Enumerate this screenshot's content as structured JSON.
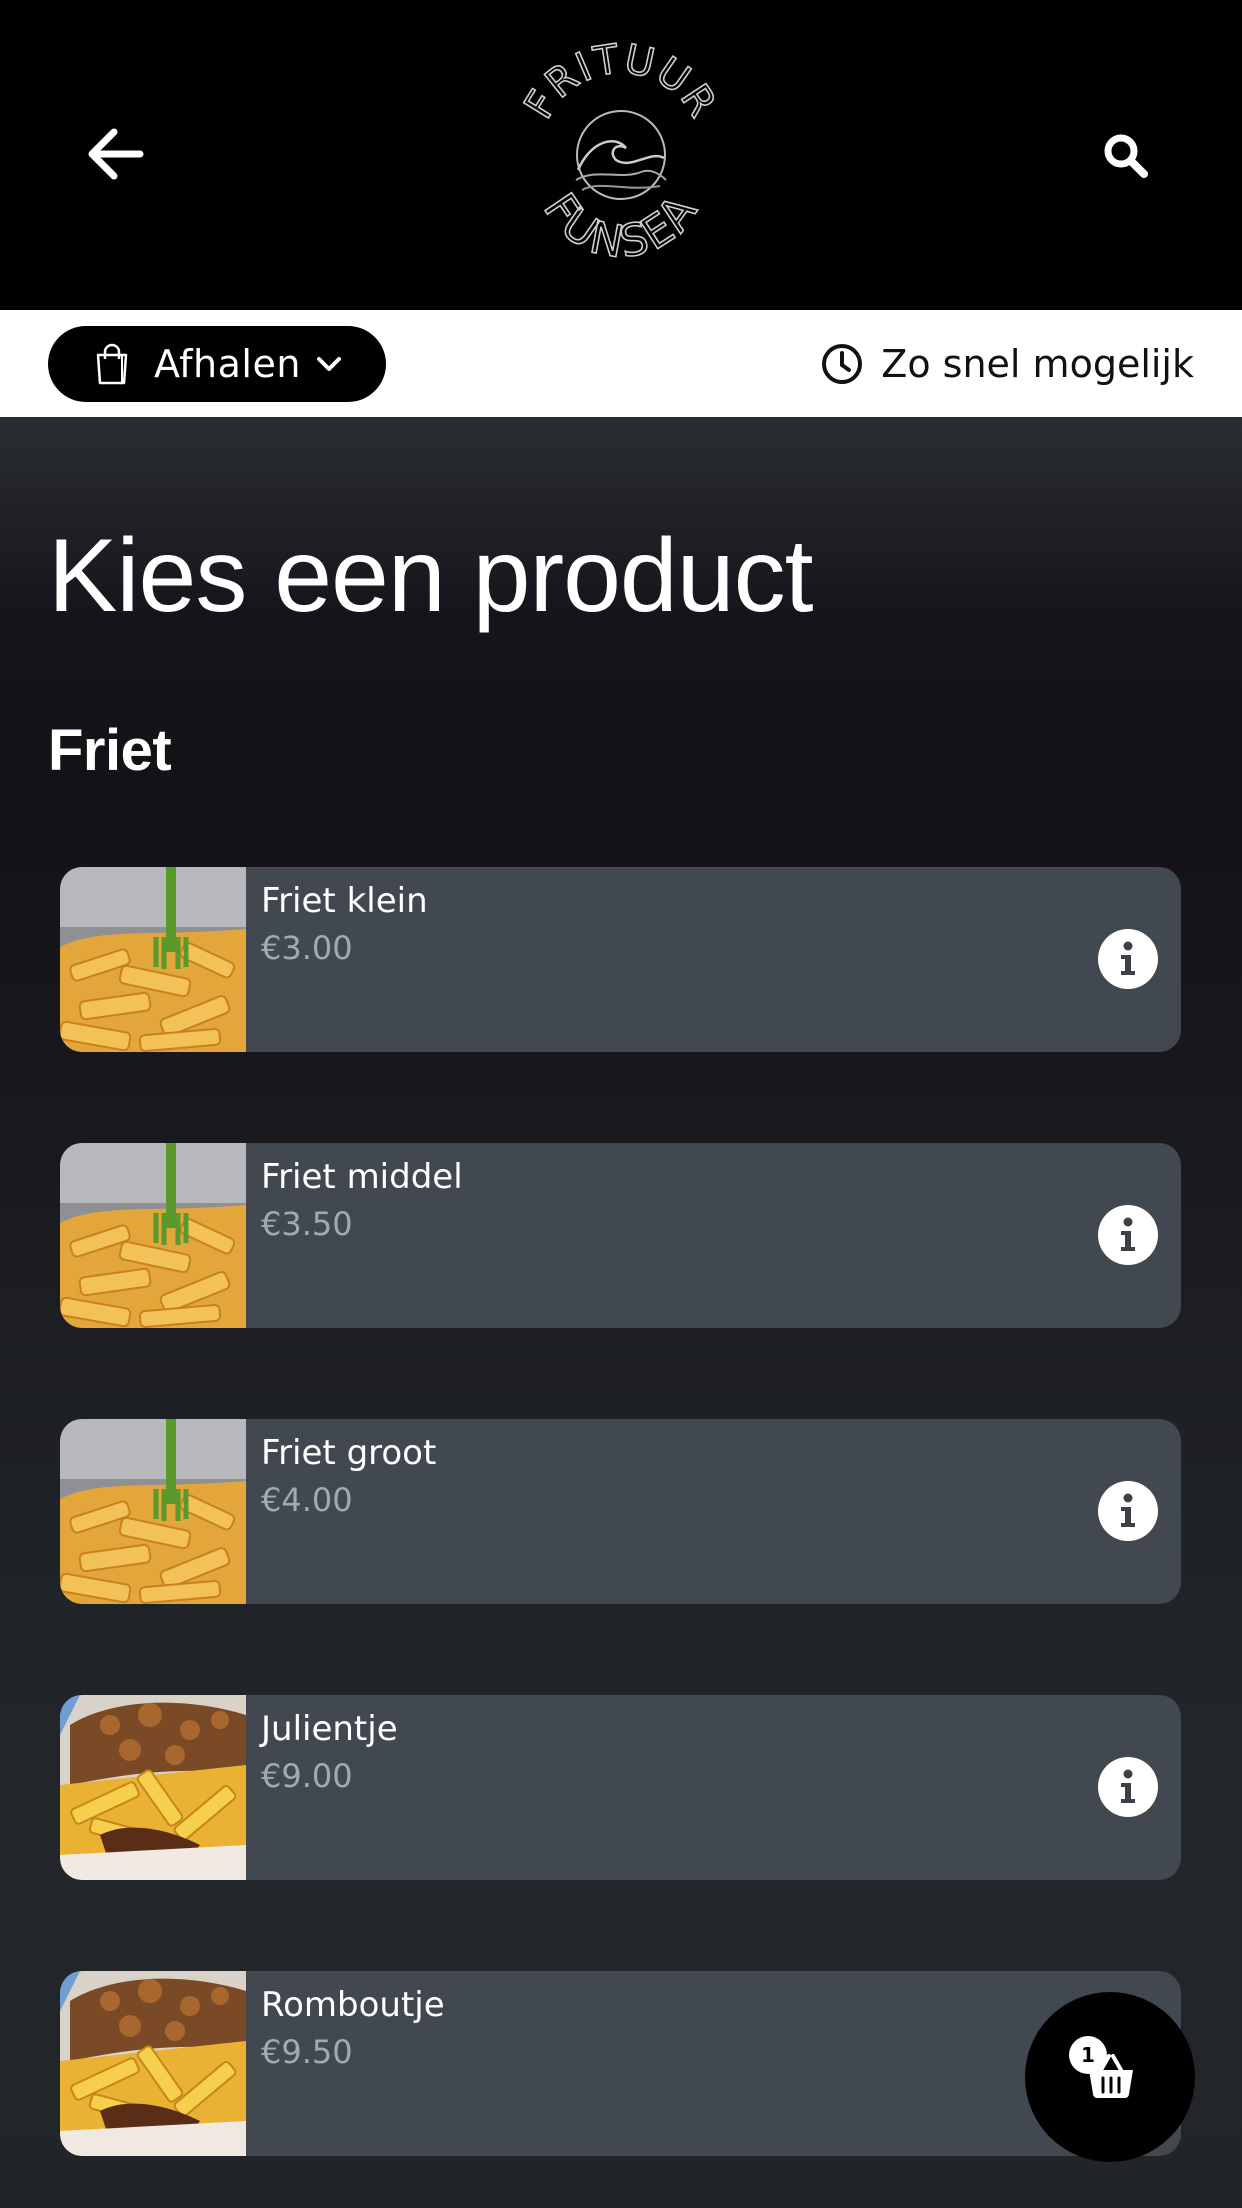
{
  "header": {
    "logo_text_top": "FRITUUR",
    "logo_text_bottom": "FUNSEA",
    "back_icon": "arrow-left-icon",
    "search_icon": "search-icon"
  },
  "order_bar": {
    "mode_label": "Afhalen",
    "mode_icon": "shopping-bag-icon",
    "time_label": "Zo snel mogelijk",
    "time_icon": "clock-icon"
  },
  "main": {
    "title": "Kies een product",
    "section_title": "Friet"
  },
  "products": [
    {
      "name": "Friet klein",
      "price": "€3.00",
      "image": "fries"
    },
    {
      "name": "Friet middel",
      "price": "€3.50",
      "image": "fries"
    },
    {
      "name": "Friet groot",
      "price": "€4.00",
      "image": "fries"
    },
    {
      "name": "Julientje",
      "price": "€9.00",
      "image": "loaded-fries"
    },
    {
      "name": "Romboutje",
      "price": "€9.50",
      "image": "loaded-fries"
    }
  ],
  "cart": {
    "count": "1",
    "icon": "basket-icon"
  },
  "colors": {
    "header_bg": "#000000",
    "card_bg": "#42484f",
    "price_text": "#a3a9b0"
  }
}
